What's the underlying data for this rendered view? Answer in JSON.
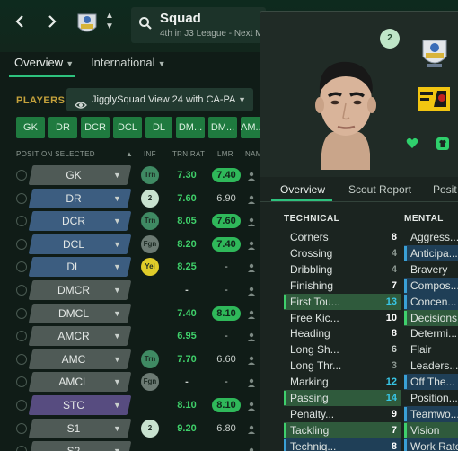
{
  "header": {
    "back_icon": "chevron-left",
    "forward_icon": "chevron-right",
    "squad_title": "Squad",
    "squad_subtitle": "4th in J3 League - Next M..."
  },
  "subnav": {
    "tabs": [
      {
        "label": "Overview",
        "active": true
      },
      {
        "label": "International",
        "active": false
      }
    ]
  },
  "players": {
    "label": "PLAYERS",
    "view_name": "JigglySquad View 24 with CA-PA",
    "position_filters": [
      "GK",
      "DR",
      "DCR",
      "DCL",
      "DL",
      "DM...",
      "DM...",
      "AM..."
    ],
    "columns": {
      "position": "POSITION SELECTED",
      "inf": "INF",
      "trn": "TRN RAT",
      "lmr": "LMR",
      "name": "NAM"
    },
    "rows": [
      {
        "pos": "GK",
        "group": "gk",
        "inf": "Trn",
        "inf_color": "#3f8a63",
        "trn": "7.30",
        "lmr": "7.40",
        "lmr_hi": true
      },
      {
        "pos": "DR",
        "group": "def",
        "inf": "2",
        "inf_color": "#c8e2cf",
        "trn": "7.60",
        "lmr": "6.90",
        "lmr_hi": false
      },
      {
        "pos": "DCR",
        "group": "def",
        "inf": "Trn",
        "inf_color": "#3f8a63",
        "trn": "8.05",
        "lmr": "7.60",
        "lmr_hi": true
      },
      {
        "pos": "DCL",
        "group": "def",
        "inf": "Fgn",
        "inf_color": "#6c7a73",
        "trn": "8.20",
        "lmr": "7.40",
        "lmr_hi": true
      },
      {
        "pos": "DL",
        "group": "def",
        "inf": "Yel",
        "inf_color": "#e0cc2a",
        "trn": "8.25",
        "lmr": "-",
        "lmr_hi": false
      },
      {
        "pos": "DMCR",
        "group": "mid",
        "inf": "",
        "inf_color": "",
        "trn": "-",
        "lmr": "-",
        "lmr_hi": false
      },
      {
        "pos": "DMCL",
        "group": "mid",
        "inf": "",
        "inf_color": "",
        "trn": "7.40",
        "lmr": "8.10",
        "lmr_hi": true
      },
      {
        "pos": "AMCR",
        "group": "mid",
        "inf": "",
        "inf_color": "",
        "trn": "6.95",
        "lmr": "-",
        "lmr_hi": false
      },
      {
        "pos": "AMC",
        "group": "mid",
        "inf": "Trn",
        "inf_color": "#3f8a63",
        "trn": "7.70",
        "lmr": "6.60",
        "lmr_hi": false
      },
      {
        "pos": "AMCL",
        "group": "mid",
        "inf": "Fgn",
        "inf_color": "#6c7a73",
        "trn": "-",
        "lmr": "-",
        "lmr_hi": false
      },
      {
        "pos": "STC",
        "group": "att",
        "inf": "",
        "inf_color": "",
        "trn": "8.10",
        "lmr": "8.10",
        "lmr_hi": true
      },
      {
        "pos": "S1",
        "group": "sub",
        "inf": "2",
        "inf_color": "#c8e2cf",
        "trn": "9.20",
        "lmr": "6.80",
        "lmr_hi": false
      },
      {
        "pos": "S2",
        "group": "sub",
        "inf": "",
        "inf_color": "",
        "trn": "",
        "lmr": "",
        "lmr_hi": false
      }
    ]
  },
  "player_panel": {
    "squad_number": "2",
    "tabs": [
      {
        "label": "Overview",
        "active": true
      },
      {
        "label": "Scout Report",
        "active": false
      },
      {
        "label": "Posit",
        "active": false
      }
    ],
    "technical": {
      "heading": "TECHNICAL",
      "attributes": [
        {
          "name": "Corners",
          "value": "8",
          "hl": ""
        },
        {
          "name": "Crossing",
          "value": "4",
          "hl": ""
        },
        {
          "name": "Dribbling",
          "value": "4",
          "hl": ""
        },
        {
          "name": "Finishing",
          "value": "7",
          "hl": ""
        },
        {
          "name": "First Tou...",
          "value": "13",
          "hl": "green"
        },
        {
          "name": "Free Kic...",
          "value": "10",
          "hl": ""
        },
        {
          "name": "Heading",
          "value": "8",
          "hl": ""
        },
        {
          "name": "Long Sh...",
          "value": "6",
          "hl": ""
        },
        {
          "name": "Long Thr...",
          "value": "3",
          "hl": ""
        },
        {
          "name": "Marking",
          "value": "12",
          "hl": ""
        },
        {
          "name": "Passing",
          "value": "14",
          "hl": "green"
        },
        {
          "name": "Penalty...",
          "value": "9",
          "hl": ""
        },
        {
          "name": "Tackling",
          "value": "7",
          "hl": "green"
        },
        {
          "name": "Techniq...",
          "value": "8",
          "hl": "blue"
        }
      ]
    },
    "mental": {
      "heading": "MENTAL",
      "attributes": [
        {
          "name": "Aggress...",
          "hl": ""
        },
        {
          "name": "Anticipa...",
          "hl": "blue"
        },
        {
          "name": "Bravery",
          "hl": ""
        },
        {
          "name": "Compos...",
          "hl": "blue"
        },
        {
          "name": "Concen...",
          "hl": "blue"
        },
        {
          "name": "Decisions",
          "hl": "green"
        },
        {
          "name": "Determi...",
          "hl": ""
        },
        {
          "name": "Flair",
          "hl": ""
        },
        {
          "name": "Leaders...",
          "hl": ""
        },
        {
          "name": "Off The...",
          "hl": "blue"
        },
        {
          "name": "Position...",
          "hl": ""
        },
        {
          "name": "Teamwo...",
          "hl": "blue"
        },
        {
          "name": "Vision",
          "hl": "green"
        },
        {
          "name": "Work Rate",
          "hl": "blue"
        }
      ]
    }
  }
}
